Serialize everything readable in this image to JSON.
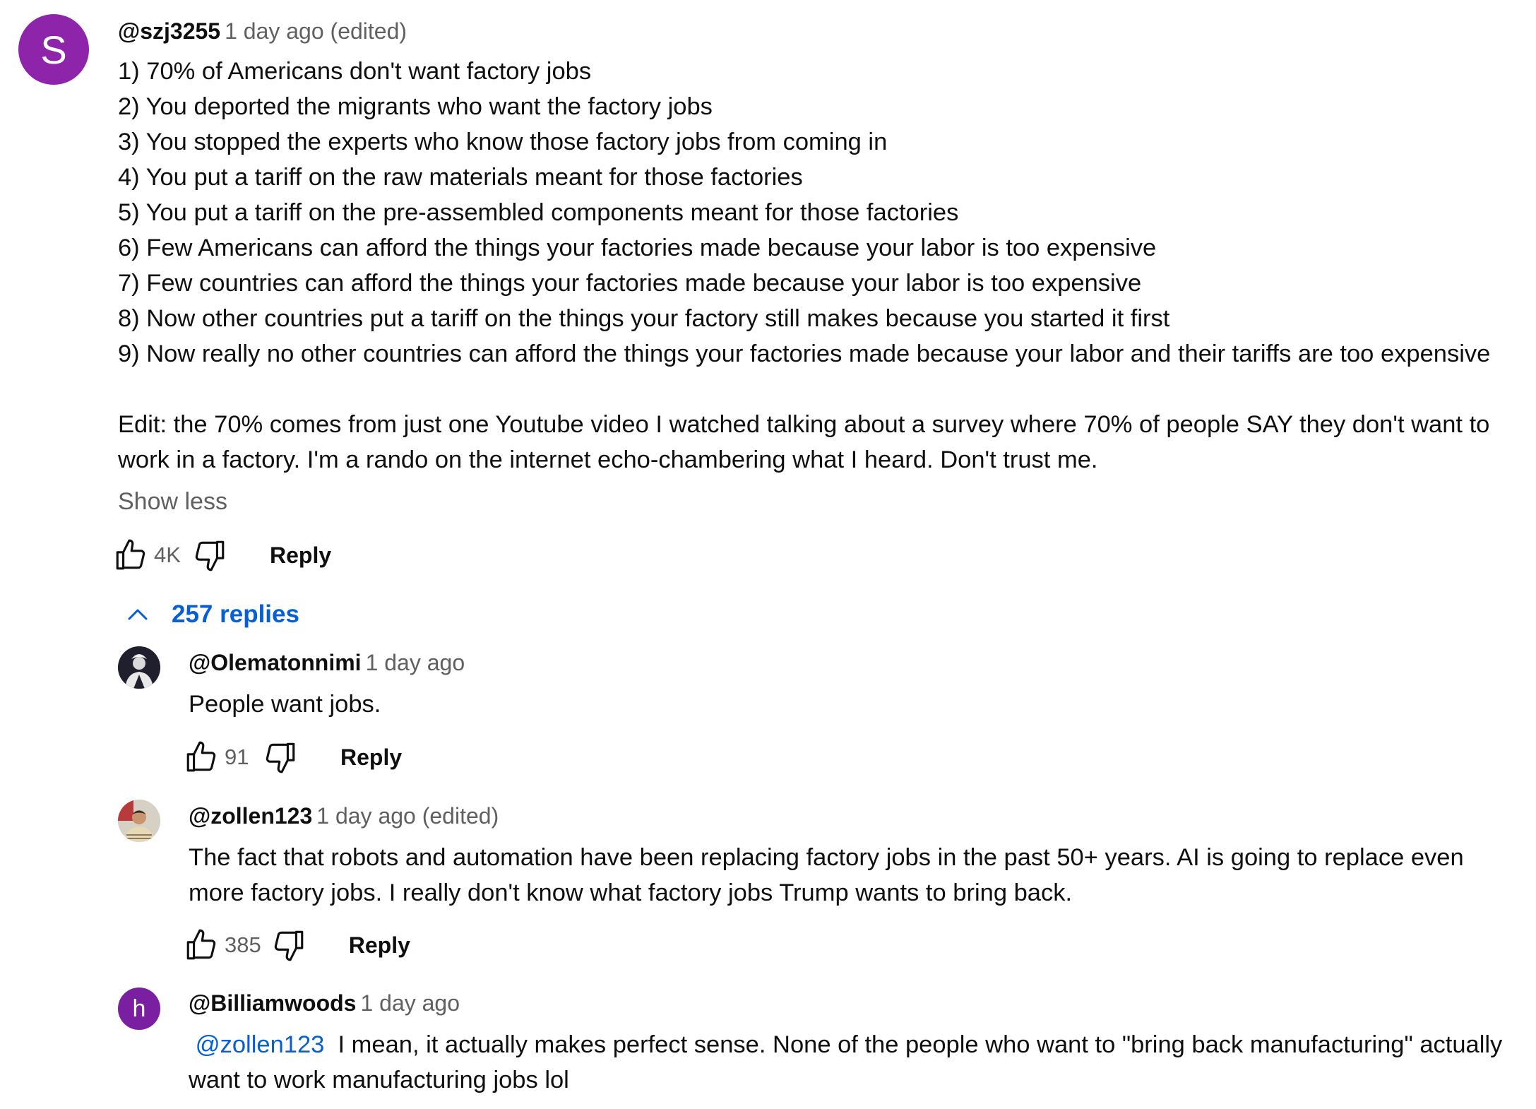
{
  "main_comment": {
    "avatar_letter": "S",
    "avatar_color": "#8e24aa",
    "handle": "@szj3255",
    "time": "1 day ago (edited)",
    "lines": [
      "1) 70% of Americans don't want factory jobs",
      "2) You deported the migrants who want the factory jobs",
      "3) You stopped the experts who know those factory jobs from coming in",
      "4) You put a tariff on the raw materials meant for those factories",
      "5) You put a tariff on the pre-assembled components meant for those factories",
      "6) Few Americans can afford the things your factories made because your labor is too expensive",
      "7) Few countries can afford the things your factories made because your labor is too expensive",
      "8) Now other countries put a tariff on the things your factory still makes because you started it first",
      "9) Now really no other countries can afford the things your factories made because your labor and their tariffs are too expensive",
      "",
      "Edit: the 70% comes from just one Youtube video I watched talking about a survey where 70% of people SAY they don't want to",
      "work in a factory. I'm a rando on the internet echo-chambering what I heard. Don't trust me."
    ],
    "show_less_label": "Show less",
    "like_count": "4K",
    "reply_label": "Reply"
  },
  "replies_toggle": {
    "label": "257 replies"
  },
  "replies": [
    {
      "avatar_type": "image",
      "handle": "@Olematonnimi",
      "time": "1 day ago",
      "mention": "",
      "lines": [
        "People want jobs."
      ],
      "like_count": "91",
      "reply_label": "Reply"
    },
    {
      "avatar_type": "image",
      "handle": "@zollen123",
      "time": "1 day ago (edited)",
      "mention": "",
      "lines": [
        "The fact that robots and automation have been replacing factory jobs in the past 50+ years. AI is going to replace even",
        "more factory jobs. I really don't know what factory jobs Trump wants to bring back."
      ],
      "like_count": "385",
      "reply_label": "Reply"
    },
    {
      "avatar_type": "letter",
      "avatar_letter": "h",
      "avatar_color": "#7b1fa2",
      "handle": "@Billiamwoods",
      "time": "1 day ago",
      "mention": "@zollen123",
      "lines": [
        "I mean, it actually makes perfect sense. None of the people who want to \"bring back manufacturing\" actually",
        "want to work manufacturing jobs lol"
      ]
    }
  ],
  "colors": {
    "link": "#065fd4",
    "secondary_text": "#606060",
    "primary_text": "#0f0f0f"
  }
}
